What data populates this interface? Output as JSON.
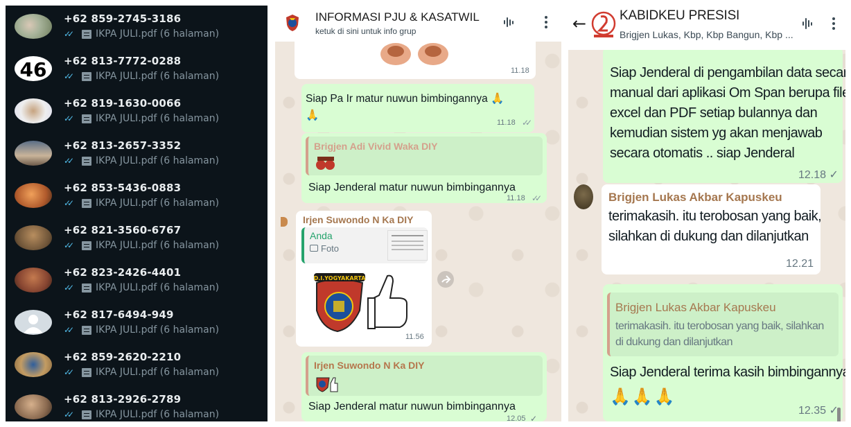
{
  "contacts": {
    "file_label": "IKPA JULI.pdf (6 halaman)",
    "items": [
      {
        "number": "+62 859-2745-3186"
      },
      {
        "number": "+62 813-7772-0288",
        "avatar_text": "46"
      },
      {
        "number": "+62 819-1630-0066"
      },
      {
        "number": "+62 813-2657-3352"
      },
      {
        "number": "+62 853-5436-0883"
      },
      {
        "number": "+62 821-3560-6767"
      },
      {
        "number": "+62 823-2426-4401"
      },
      {
        "number": "+62 817-6494-949"
      },
      {
        "number": "+62 859-2620-2210"
      },
      {
        "number": "+62 813-2926-2789"
      }
    ]
  },
  "group_chat": {
    "title": "INFORMASI PJU & KASATWIL",
    "subtitle": "ketuk di sini untuk info grup",
    "messages": [
      {
        "time": "11.18"
      },
      {
        "text1": "Siap Pa Ir matur nuwun bimbingannya 🙏",
        "text2": "🙏",
        "time": "11.18"
      },
      {
        "quote_name": "Brigjen Adi Vivid Waka DIY",
        "text": "Siap Jenderal matur nuwun bimbingannya",
        "time": "11.18"
      },
      {
        "sender": "Irjen Suwondo N Ka DIY",
        "reply_name": "Anda",
        "reply_text": "Foto",
        "sticker_text": "D.I.YOGYAKARTA",
        "time": "11.56"
      },
      {
        "quote_name": "Irjen Suwondo N Ka DIY",
        "text": "Siap Jenderal matur nuwun bimbingannya",
        "time": "12.05"
      }
    ]
  },
  "kabid_chat": {
    "title": "KABIDKEU PRESISI",
    "subtitle": "Brigjen Lukas, Kbp, Kbp Bangun, Kbp ...",
    "messages": [
      {
        "lines": [
          "Siap Jenderal di pengambilan data secara",
          "manual dari aplikasi Om Span berupa file",
          "excel dan PDF setiap bulannya dan",
          "kemudian sistem yg akan menjawab",
          "secara otomatis .. siap Jenderal"
        ],
        "time": "12.18 ✓"
      },
      {
        "sender": "Brigjen Lukas Akbar Kapuskeu",
        "lines": [
          "terimakasih. itu terobosan yang baik,",
          "silahkan di dukung dan dilanjutkan"
        ],
        "time": "12.21"
      },
      {
        "quote_name": "Brigjen Lukas Akbar Kapuskeu",
        "quote_lines": [
          "terimakasih. itu terobosan yang baik, silahkan",
          "di dukung dan dilanjutkan"
        ],
        "text": "Siap Jenderal terima kasih bimbingannya",
        "emoji": "🙏🙏🙏",
        "time": "12.35 ✓"
      }
    ]
  },
  "colors": {
    "dark_bg": "#0c141a",
    "bubble_green": "#d9fdd3",
    "read_tick": "#53bdeb",
    "quote_name_brown": "#a5774f"
  }
}
